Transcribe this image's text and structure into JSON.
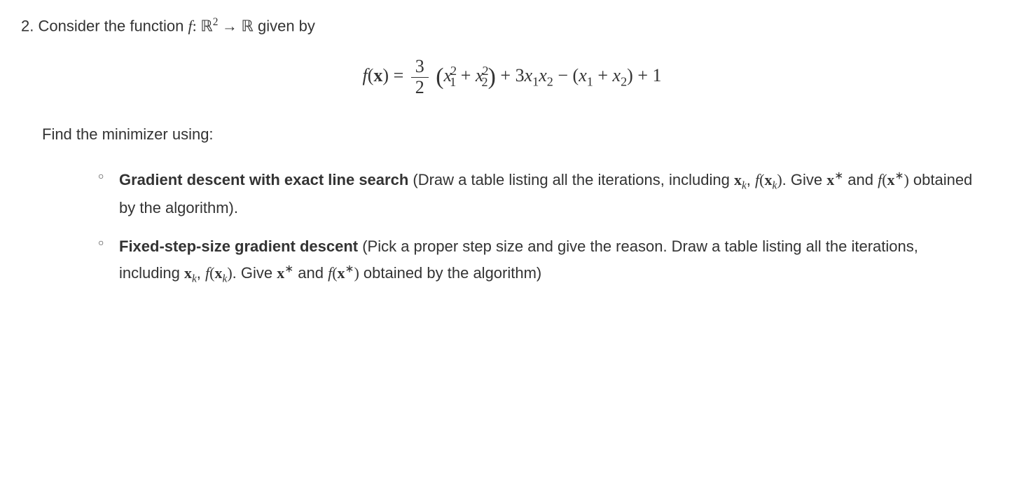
{
  "problem": {
    "number": "2.",
    "intro_prefix": "Consider the function ",
    "intro_suffix": " given by",
    "function_decl": {
      "f": "f",
      "colon": ": ",
      "domain": "ℝ",
      "domain_sup": "2",
      "arrow": " → ",
      "codomain": "ℝ"
    },
    "equation": {
      "lhs_f": "f",
      "lhs_paren_open": "(",
      "lhs_x": "x",
      "lhs_paren_close": ")",
      "equals": " = ",
      "frac_num": "3",
      "frac_den": "2",
      "term1_open": "(",
      "x1": "x",
      "sub1": "1",
      "sup2": "2",
      "plus1": " + ",
      "x2": "x",
      "sub2": "2",
      "term1_close": ")",
      "plus2": " + 3",
      "x1b": "x",
      "x2b": "x",
      "minus": " − ",
      "term3_open": "(",
      "plus3": " + ",
      "term3_close": ")",
      "plus4": " + 1"
    },
    "instruction": "Find the minimizer using:",
    "bullets": [
      {
        "title": "Gradient descent with exact line search",
        "text_prefix": " (Draw a table listing all the iterations, including ",
        "xk": "x",
        "xk_sub": "k",
        "comma": ", ",
        "fxk": "f",
        "text_mid": ". Give ",
        "xstar": "x",
        "star": "∗",
        "and": " and ",
        "text_suffix": " obtained by the algorithm)."
      },
      {
        "title": "Fixed-step-size gradient descent",
        "text_prefix": " (Pick a proper step size and give the reason. Draw a table listing all the iterations, including ",
        "xk": "x",
        "xk_sub": "k",
        "comma": ", ",
        "fxk": "f",
        "text_mid": ". Give ",
        "xstar": "x",
        "star": "∗",
        "and": " and ",
        "text_suffix": " obtained by the algorithm)"
      }
    ]
  }
}
